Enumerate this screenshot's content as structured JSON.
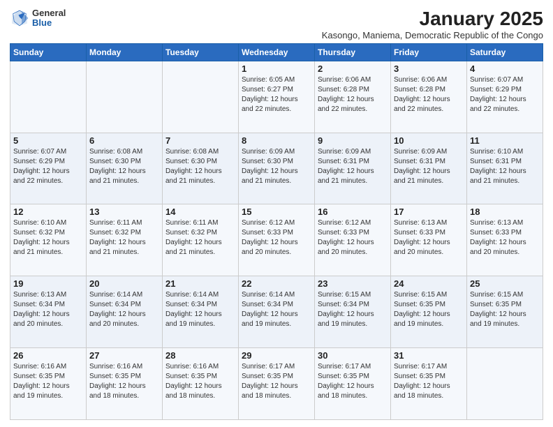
{
  "logo": {
    "general": "General",
    "blue": "Blue"
  },
  "title": "January 2025",
  "subtitle": "Kasongo, Maniema, Democratic Republic of the Congo",
  "days_of_week": [
    "Sunday",
    "Monday",
    "Tuesday",
    "Wednesday",
    "Thursday",
    "Friday",
    "Saturday"
  ],
  "weeks": [
    [
      {
        "day": "",
        "sunrise": "",
        "sunset": "",
        "daylight": ""
      },
      {
        "day": "",
        "sunrise": "",
        "sunset": "",
        "daylight": ""
      },
      {
        "day": "",
        "sunrise": "",
        "sunset": "",
        "daylight": ""
      },
      {
        "day": "1",
        "sunrise": "Sunrise: 6:05 AM",
        "sunset": "Sunset: 6:27 PM",
        "daylight": "Daylight: 12 hours and 22 minutes."
      },
      {
        "day": "2",
        "sunrise": "Sunrise: 6:06 AM",
        "sunset": "Sunset: 6:28 PM",
        "daylight": "Daylight: 12 hours and 22 minutes."
      },
      {
        "day": "3",
        "sunrise": "Sunrise: 6:06 AM",
        "sunset": "Sunset: 6:28 PM",
        "daylight": "Daylight: 12 hours and 22 minutes."
      },
      {
        "day": "4",
        "sunrise": "Sunrise: 6:07 AM",
        "sunset": "Sunset: 6:29 PM",
        "daylight": "Daylight: 12 hours and 22 minutes."
      }
    ],
    [
      {
        "day": "5",
        "sunrise": "Sunrise: 6:07 AM",
        "sunset": "Sunset: 6:29 PM",
        "daylight": "Daylight: 12 hours and 22 minutes."
      },
      {
        "day": "6",
        "sunrise": "Sunrise: 6:08 AM",
        "sunset": "Sunset: 6:30 PM",
        "daylight": "Daylight: 12 hours and 21 minutes."
      },
      {
        "day": "7",
        "sunrise": "Sunrise: 6:08 AM",
        "sunset": "Sunset: 6:30 PM",
        "daylight": "Daylight: 12 hours and 21 minutes."
      },
      {
        "day": "8",
        "sunrise": "Sunrise: 6:09 AM",
        "sunset": "Sunset: 6:30 PM",
        "daylight": "Daylight: 12 hours and 21 minutes."
      },
      {
        "day": "9",
        "sunrise": "Sunrise: 6:09 AM",
        "sunset": "Sunset: 6:31 PM",
        "daylight": "Daylight: 12 hours and 21 minutes."
      },
      {
        "day": "10",
        "sunrise": "Sunrise: 6:09 AM",
        "sunset": "Sunset: 6:31 PM",
        "daylight": "Daylight: 12 hours and 21 minutes."
      },
      {
        "day": "11",
        "sunrise": "Sunrise: 6:10 AM",
        "sunset": "Sunset: 6:31 PM",
        "daylight": "Daylight: 12 hours and 21 minutes."
      }
    ],
    [
      {
        "day": "12",
        "sunrise": "Sunrise: 6:10 AM",
        "sunset": "Sunset: 6:32 PM",
        "daylight": "Daylight: 12 hours and 21 minutes."
      },
      {
        "day": "13",
        "sunrise": "Sunrise: 6:11 AM",
        "sunset": "Sunset: 6:32 PM",
        "daylight": "Daylight: 12 hours and 21 minutes."
      },
      {
        "day": "14",
        "sunrise": "Sunrise: 6:11 AM",
        "sunset": "Sunset: 6:32 PM",
        "daylight": "Daylight: 12 hours and 21 minutes."
      },
      {
        "day": "15",
        "sunrise": "Sunrise: 6:12 AM",
        "sunset": "Sunset: 6:33 PM",
        "daylight": "Daylight: 12 hours and 20 minutes."
      },
      {
        "day": "16",
        "sunrise": "Sunrise: 6:12 AM",
        "sunset": "Sunset: 6:33 PM",
        "daylight": "Daylight: 12 hours and 20 minutes."
      },
      {
        "day": "17",
        "sunrise": "Sunrise: 6:13 AM",
        "sunset": "Sunset: 6:33 PM",
        "daylight": "Daylight: 12 hours and 20 minutes."
      },
      {
        "day": "18",
        "sunrise": "Sunrise: 6:13 AM",
        "sunset": "Sunset: 6:33 PM",
        "daylight": "Daylight: 12 hours and 20 minutes."
      }
    ],
    [
      {
        "day": "19",
        "sunrise": "Sunrise: 6:13 AM",
        "sunset": "Sunset: 6:34 PM",
        "daylight": "Daylight: 12 hours and 20 minutes."
      },
      {
        "day": "20",
        "sunrise": "Sunrise: 6:14 AM",
        "sunset": "Sunset: 6:34 PM",
        "daylight": "Daylight: 12 hours and 20 minutes."
      },
      {
        "day": "21",
        "sunrise": "Sunrise: 6:14 AM",
        "sunset": "Sunset: 6:34 PM",
        "daylight": "Daylight: 12 hours and 19 minutes."
      },
      {
        "day": "22",
        "sunrise": "Sunrise: 6:14 AM",
        "sunset": "Sunset: 6:34 PM",
        "daylight": "Daylight: 12 hours and 19 minutes."
      },
      {
        "day": "23",
        "sunrise": "Sunrise: 6:15 AM",
        "sunset": "Sunset: 6:34 PM",
        "daylight": "Daylight: 12 hours and 19 minutes."
      },
      {
        "day": "24",
        "sunrise": "Sunrise: 6:15 AM",
        "sunset": "Sunset: 6:35 PM",
        "daylight": "Daylight: 12 hours and 19 minutes."
      },
      {
        "day": "25",
        "sunrise": "Sunrise: 6:15 AM",
        "sunset": "Sunset: 6:35 PM",
        "daylight": "Daylight: 12 hours and 19 minutes."
      }
    ],
    [
      {
        "day": "26",
        "sunrise": "Sunrise: 6:16 AM",
        "sunset": "Sunset: 6:35 PM",
        "daylight": "Daylight: 12 hours and 19 minutes."
      },
      {
        "day": "27",
        "sunrise": "Sunrise: 6:16 AM",
        "sunset": "Sunset: 6:35 PM",
        "daylight": "Daylight: 12 hours and 18 minutes."
      },
      {
        "day": "28",
        "sunrise": "Sunrise: 6:16 AM",
        "sunset": "Sunset: 6:35 PM",
        "daylight": "Daylight: 12 hours and 18 minutes."
      },
      {
        "day": "29",
        "sunrise": "Sunrise: 6:17 AM",
        "sunset": "Sunset: 6:35 PM",
        "daylight": "Daylight: 12 hours and 18 minutes."
      },
      {
        "day": "30",
        "sunrise": "Sunrise: 6:17 AM",
        "sunset": "Sunset: 6:35 PM",
        "daylight": "Daylight: 12 hours and 18 minutes."
      },
      {
        "day": "31",
        "sunrise": "Sunrise: 6:17 AM",
        "sunset": "Sunset: 6:35 PM",
        "daylight": "Daylight: 12 hours and 18 minutes."
      },
      {
        "day": "",
        "sunrise": "",
        "sunset": "",
        "daylight": ""
      }
    ]
  ]
}
